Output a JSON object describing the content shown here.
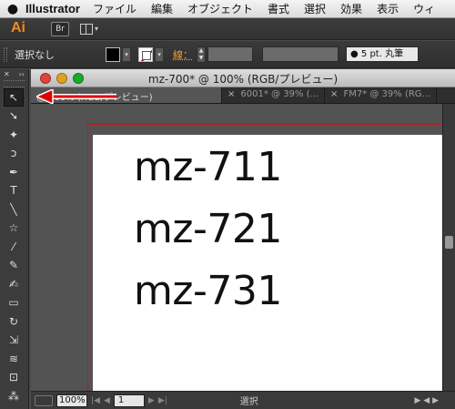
{
  "menubar": {
    "app_name": "Illustrator",
    "items": [
      "ファイル",
      "編集",
      "オブジェクト",
      "書式",
      "選択",
      "効果",
      "表示",
      "ウィ"
    ]
  },
  "appbar": {
    "logo": "Ai",
    "bridge": "Br"
  },
  "controlbar": {
    "selection": "選択なし",
    "stroke_label": "線：",
    "brush": "5 pt. 丸筆"
  },
  "tools": {
    "header_left": "✕",
    "header_right": "››",
    "items": [
      {
        "name": "selection-tool",
        "glyph": "↖",
        "active": true
      },
      {
        "name": "direct-selection-tool",
        "glyph": "➘"
      },
      {
        "name": "magic-wand-tool",
        "glyph": "✦"
      },
      {
        "name": "lasso-tool",
        "glyph": "ↄ"
      },
      {
        "name": "pen-tool",
        "glyph": "✒"
      },
      {
        "name": "type-tool",
        "glyph": "T"
      },
      {
        "name": "line-tool",
        "glyph": "╲"
      },
      {
        "name": "star-tool",
        "glyph": "☆"
      },
      {
        "name": "paintbrush-tool",
        "glyph": "⁄"
      },
      {
        "name": "pencil-tool",
        "glyph": "✎"
      },
      {
        "name": "blob-brush-tool",
        "glyph": "✍"
      },
      {
        "name": "eraser-tool",
        "glyph": "▭"
      },
      {
        "name": "rotate-tool",
        "glyph": "↻"
      },
      {
        "name": "scale-tool",
        "glyph": "⇲"
      },
      {
        "name": "warp-tool",
        "glyph": "≋"
      },
      {
        "name": "free-transform-tool",
        "glyph": "⊡"
      },
      {
        "name": "symbol-sprayer-tool",
        "glyph": "⁂"
      }
    ]
  },
  "document": {
    "window_title": "mz-700* @ 100% (RGB/プレビュー)",
    "tabs": [
      {
        "label": "@ 100% (RGB/プレビュー)",
        "active": true,
        "close": ""
      },
      {
        "label": "6001* @ 39% (...",
        "active": false,
        "close": "×"
      },
      {
        "label": "FM7* @ 39% (RG...",
        "active": false,
        "close": "×"
      }
    ],
    "art_lines": [
      "mz-711",
      "mz-721",
      "mz-731"
    ]
  },
  "statusbar": {
    "zoom": "100%",
    "page": "1",
    "selection_tool": "選択"
  },
  "colors": {
    "annotation_arrow": "#e00000",
    "ai_logo": "#f08b1d",
    "artboard_border": "#b02020"
  }
}
